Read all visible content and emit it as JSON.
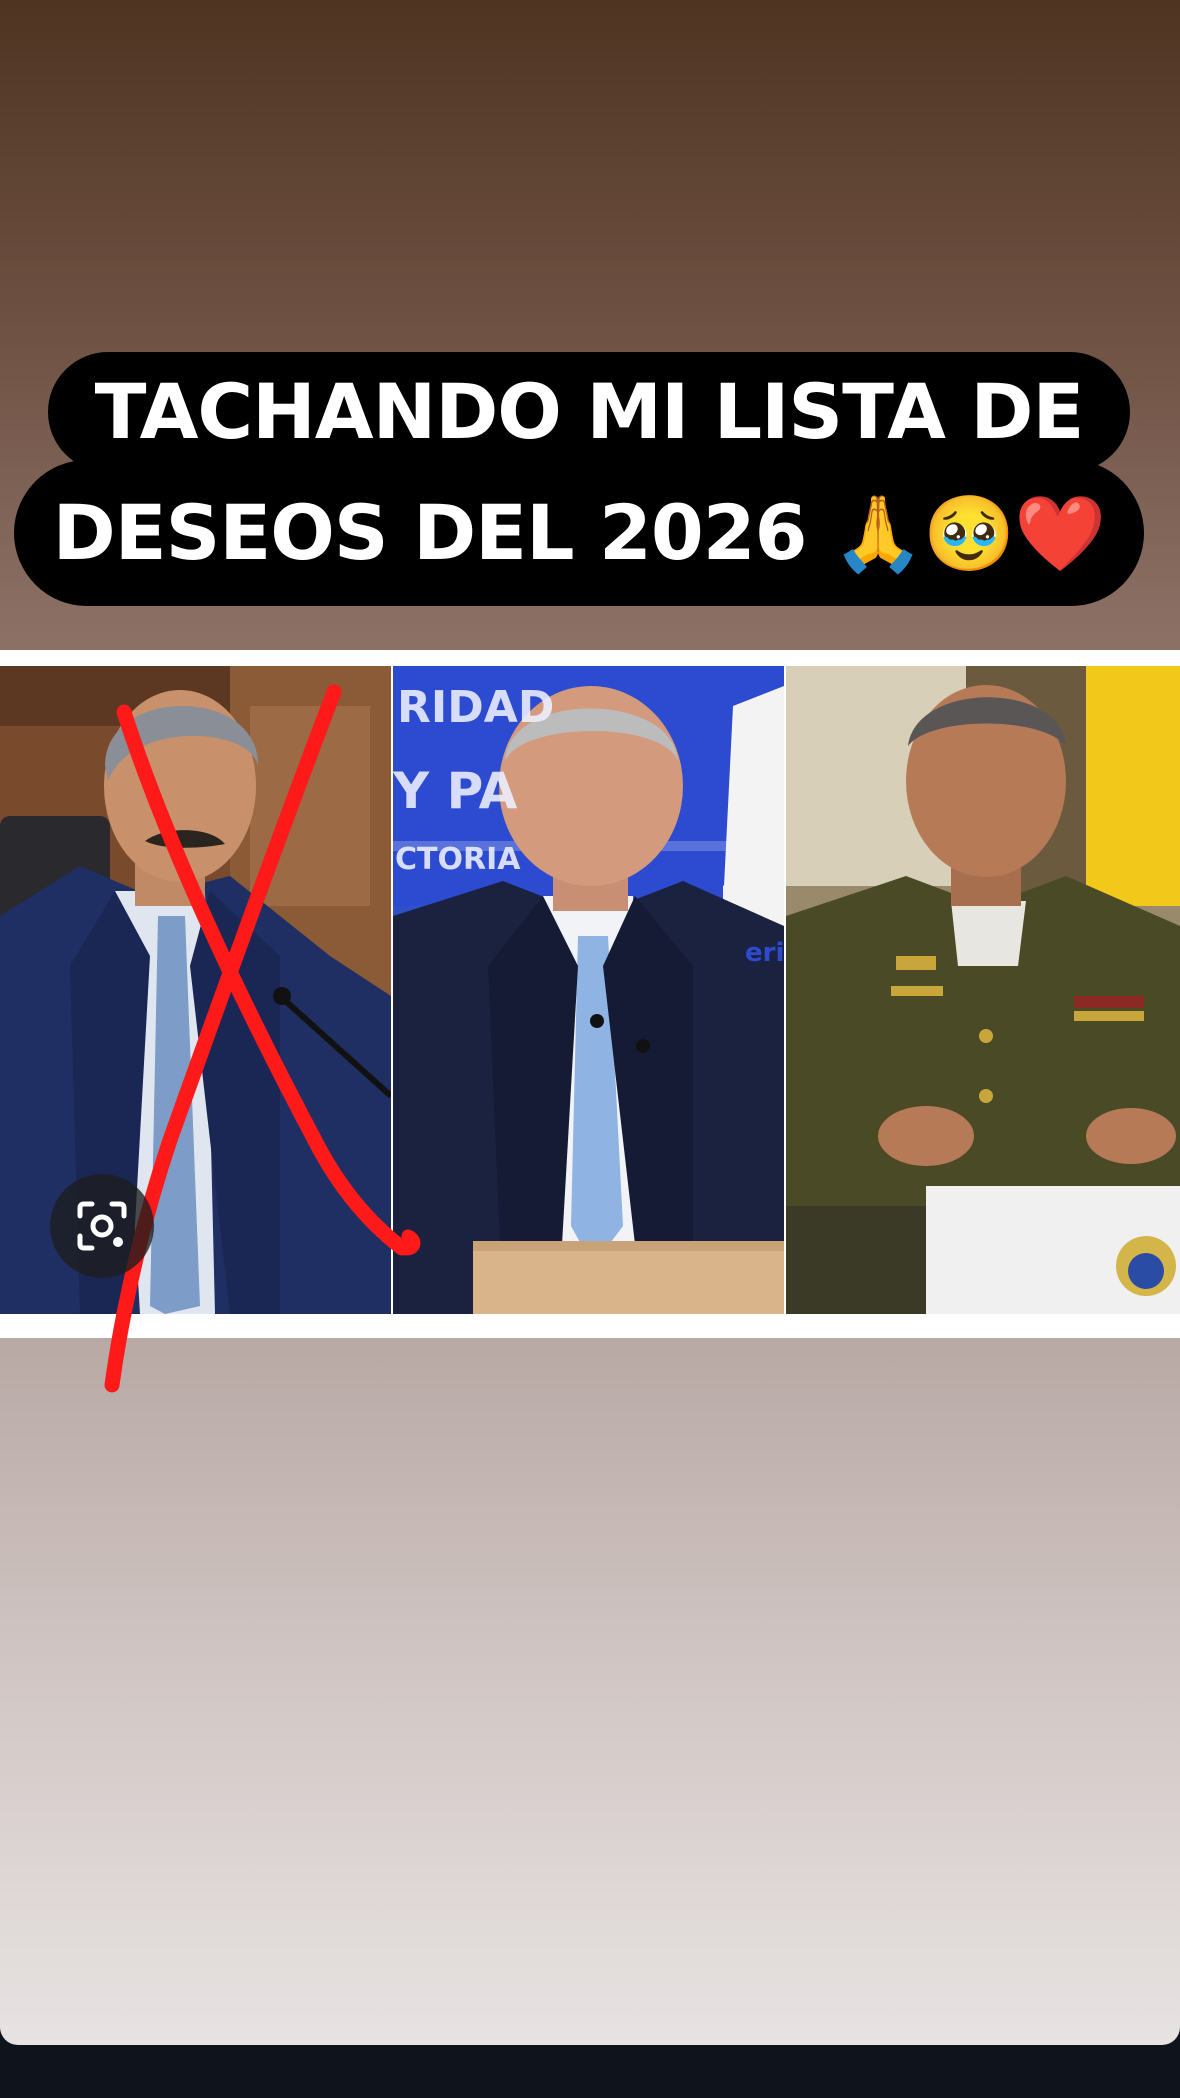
{
  "caption": {
    "line1": "TACHANDO MI LISTA DE",
    "line2_text": "DESEOS DEL 2026 ",
    "line2_emojis": "🙏🥹❤️"
  },
  "panels": [
    {
      "background_text": []
    },
    {
      "background_text": [
        "RIDAD",
        "Y PA",
        "CTORIA",
        "eri"
      ]
    },
    {
      "background_text": []
    }
  ],
  "icons": {
    "lens": "lens-camera-icon"
  },
  "colors": {
    "cross": "#ff1a1a",
    "caption_bg": "#000000",
    "caption_text": "#ffffff"
  }
}
